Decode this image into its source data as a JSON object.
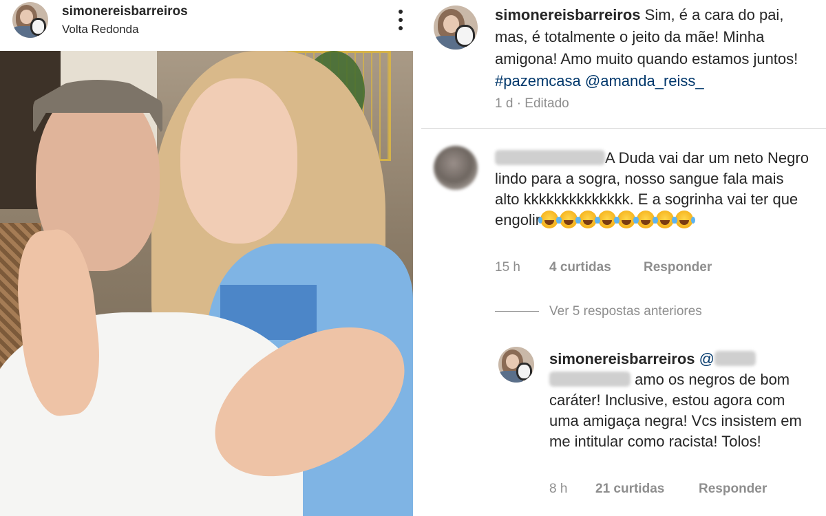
{
  "post": {
    "username": "simonereisbarreiros",
    "location": "Volta Redonda",
    "more_icon": "more-vertical-icon"
  },
  "caption": {
    "username": "simonereisbarreiros",
    "text": " Sim, é a cara do pai, mas, é totalmente o jeito da mãe! Minha amigona! Amo muito quando estamos juntos! ",
    "hashtag": "#pazemcasa",
    "mention": "@amanda_reiss_",
    "time": "1 d",
    "edited": "· Editado"
  },
  "comment1": {
    "username_hidden": "luis.braboo22",
    "text": "A Duda vai dar um neto Negro lindo para a sogra, nosso sangue fala mais alto kkkkkkkkkkkkkk. E a sogrinha vai ter que engolir",
    "emoji_count": 8,
    "emoji_icon": "tears-of-joy-emoji",
    "time": "15 h",
    "likes": "4 curtidas",
    "reply": "Responder"
  },
  "replies_toggle": "Ver 5 respostas anteriores",
  "comment2": {
    "username": "simonereisbarreiros",
    "mention_prefix": "@",
    "text": " amo os negros de bom caráter! Inclusive, estou agora com uma amigaça negra! Vcs insistem em me intitular como racista! Tolos!",
    "time": "8 h",
    "likes": "21 curtidas",
    "reply": "Responder"
  },
  "colors": {
    "text": "#262626",
    "secondary": "#8e8e8e",
    "link": "#00376b",
    "separator": "#dbdbdb"
  }
}
